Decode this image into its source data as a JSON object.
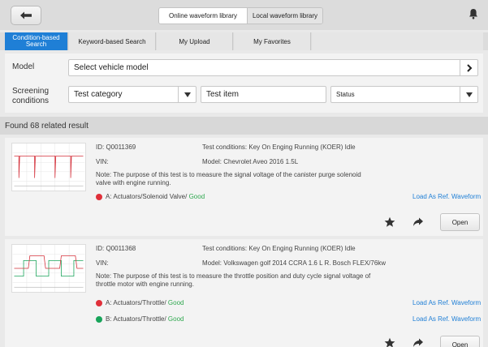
{
  "top_bar": {
    "tabs": [
      "Online waveform library",
      "Local waveform library"
    ],
    "active_tab": 0
  },
  "search_tabs": {
    "items": [
      {
        "label": "Condition-based Search"
      },
      {
        "label": "Keyword-based Search"
      },
      {
        "label": "My Upload"
      },
      {
        "label": "My Favorites"
      }
    ]
  },
  "filters": {
    "model_label": "Model",
    "model_placeholder": "Select vehicle model",
    "screening_label": "Screening conditions",
    "test_category": "Test category",
    "test_item": "Test item",
    "status": "Status"
  },
  "results": {
    "summary": "Found 68 related result",
    "items": [
      {
        "id": "ID: Q0011369",
        "vin": "VIN:",
        "conditions": "Test conditions: Key On Enging Running (KOER) Idle",
        "model": "Model: Chevrolet Aveo 2016 1.5L",
        "note": "Note: The purpose of this test is to measure the signal voltage of the canister purge solenoid valve with engine running.",
        "channels": [
          {
            "prefix": "A: Actuators/Solenoid Valve/ ",
            "status": "Good",
            "color": "#e0303a"
          }
        ],
        "load_label": "Load As Ref. Waveform",
        "open_label": "Open"
      },
      {
        "id": "ID: Q0011368",
        "vin": "VIN:",
        "conditions": "Test conditions: Key On Enging Running (KOER) Idle",
        "model": "Model: Volkswagen golf 2014 CCRA 1.6 L R. Bosch FLEX/76kw",
        "note": "Note: The purpose of this test is to measure the throttle position and duty cycle signal voltage of throttle motor with engine running.",
        "channels": [
          {
            "prefix": "A: Actuators/Throttle/ ",
            "status": "Good",
            "color": "#e0303a"
          },
          {
            "prefix": "B: Actuators/Throttle/ ",
            "status": "Good",
            "color": "#18a45a"
          }
        ],
        "load_label": "Load As Ref. Waveform",
        "open_label": "Open"
      }
    ]
  },
  "icons": [
    "back-arrow-icon",
    "bell-icon",
    "chevron-right-icon",
    "triangle-down-icon",
    "star-icon",
    "share-icon"
  ]
}
